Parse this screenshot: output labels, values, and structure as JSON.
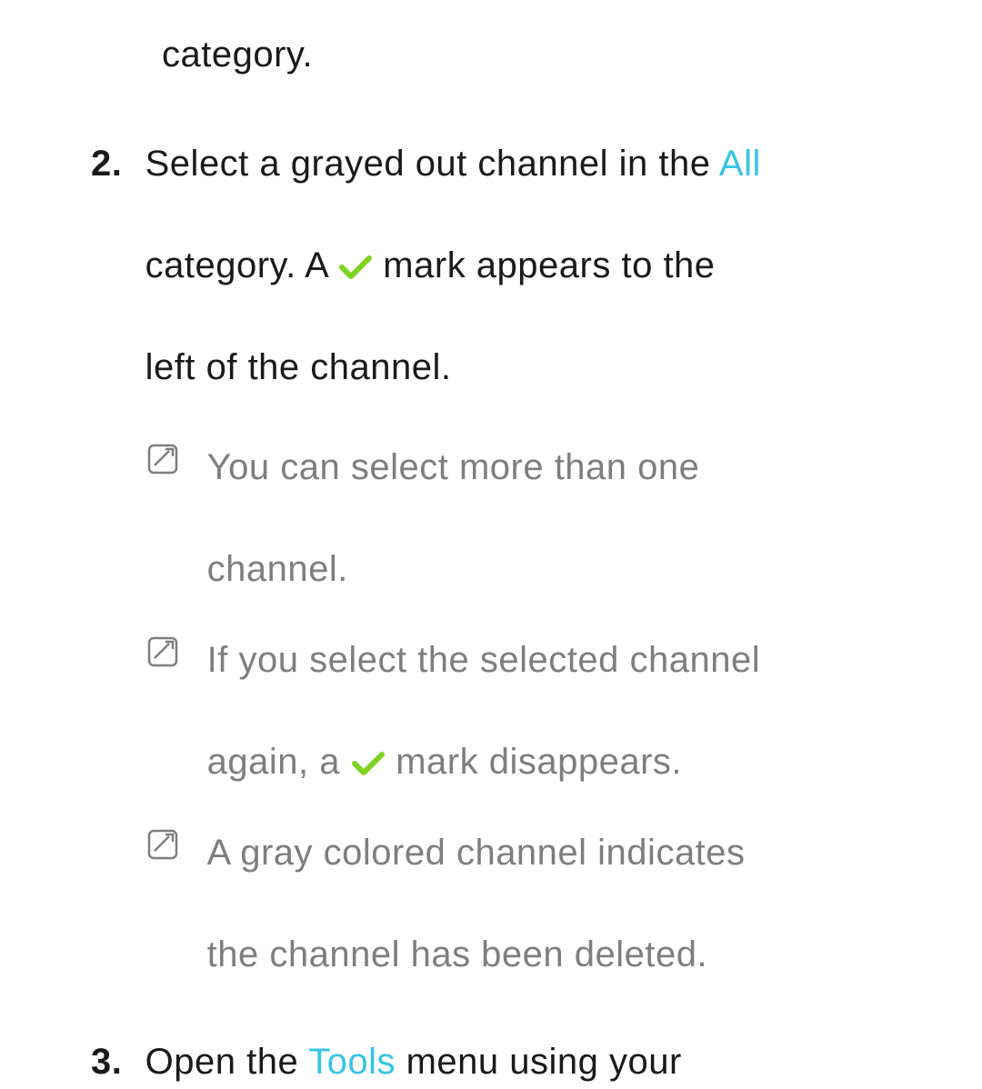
{
  "fragment_top": "category.",
  "step2": {
    "number": "2.",
    "l1a": "Select a grayed out channel in the ",
    "l1_highlight": "All",
    "l2a": "category. A ",
    "l2b": " mark appears to the",
    "l3": "left of the channel."
  },
  "notes": {
    "n1": {
      "l1": "You can select more than one",
      "l2": "channel."
    },
    "n2": {
      "l1": "If you select the selected channel",
      "l2a": "again, a ",
      "l2b": " mark disappears."
    },
    "n3": {
      "l1": "A gray colored channel indicates",
      "l2": "the channel has been deleted."
    }
  },
  "step3": {
    "number": "3.",
    "l1a": "Open the ",
    "l1_highlight": "Tools",
    "l1b": " menu using your"
  },
  "icons": {
    "check": "check-icon",
    "note": "note-icon"
  }
}
